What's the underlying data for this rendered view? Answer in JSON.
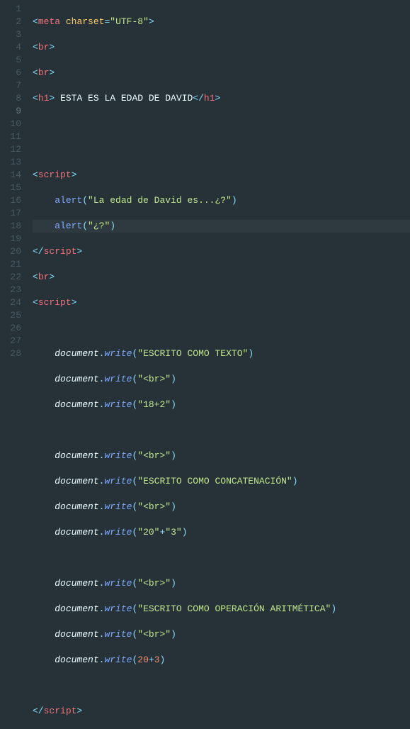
{
  "lines": {
    "ln1": "1",
    "ln2": "2",
    "ln3": "3",
    "ln4": "4",
    "ln5": "5",
    "ln6": "6",
    "ln7": "7",
    "ln8": "8",
    "ln9": "9",
    "ln10": "10",
    "ln11": "11",
    "ln12": "12",
    "ln13": "13",
    "ln14": "14",
    "ln15": "15",
    "ln16": "16",
    "ln17": "17",
    "ln18": "18",
    "ln19": "19",
    "ln20": "20",
    "ln21": "21",
    "ln22": "22",
    "ln23": "23",
    "ln24": "24",
    "ln25": "25",
    "ln26": "26",
    "ln27": "27",
    "ln28": "28"
  },
  "t": {
    "lt": "<",
    "gt": ">",
    "lts": "</",
    "eq": "=",
    "meta": "meta",
    "charset": "charset",
    "utf8": "\"UTF-8\"",
    "br": "br",
    "h1": "h1",
    "h1text": " ESTA ES LA EDAD DE DAVID",
    "script": "script",
    "alert": "alert",
    "s_alert1": "\"La edad de David es...¿?\"",
    "s_alert2": "\"¿?\"",
    "lp": "(",
    "rp": ")",
    "document": "document",
    "dot": ".",
    "write": "write",
    "s_txt1": "\"ESCRITO COMO TEXTO\"",
    "s_br": "\"<br>\"",
    "s_18p2": "\"18+2\"",
    "s_txt2": "\"ESCRITO COMO CONCATENACIÓN\"",
    "s_20": "\"20\"",
    "plus": "+",
    "s_3": "\"3\"",
    "s_txt3": "\"ESCRITO COMO OPERACIÓN ARITMÉTICA\"",
    "n20": "20",
    "n3": "3"
  }
}
